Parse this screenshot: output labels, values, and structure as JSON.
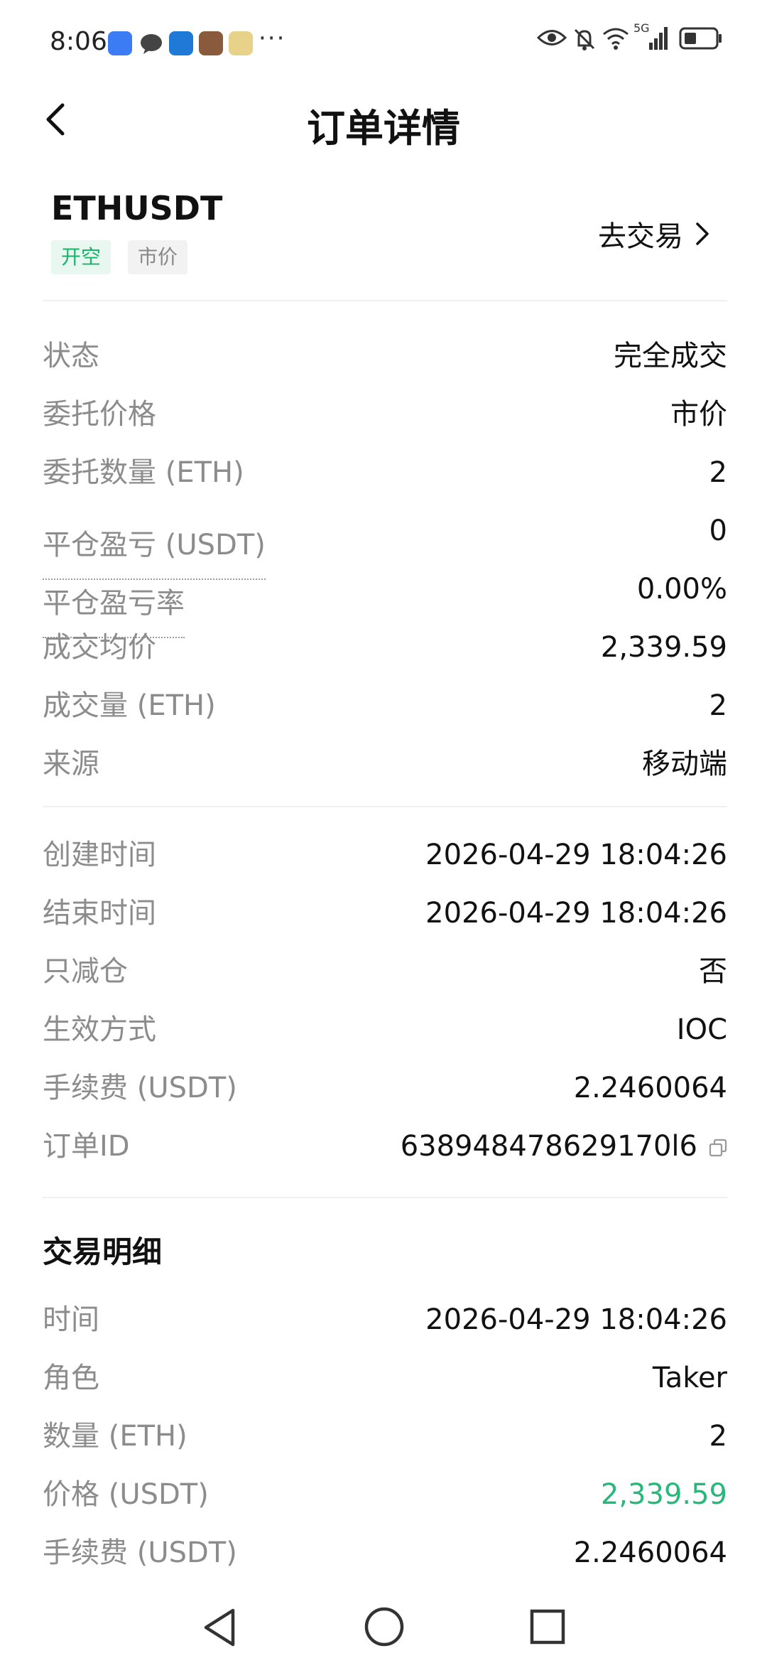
{
  "status_bar": {
    "time": "8:06",
    "dots": "···",
    "network": "5G"
  },
  "header": {
    "title": "订单详情"
  },
  "symbol": {
    "name": "ETHUSDT",
    "tags": [
      "开空",
      "市价"
    ],
    "trade_link": "去交易"
  },
  "order_details": [
    {
      "label": "状态",
      "value": "完全成交"
    },
    {
      "label": "委托价格",
      "value": "市价"
    },
    {
      "label": "委托数量 (ETH)",
      "value": "2"
    },
    {
      "label": "平仓盈亏 (USDT)",
      "value": "0"
    },
    {
      "label": "平仓盈亏率",
      "value": "0.00%"
    },
    {
      "label": "成交均价",
      "value": "2,339.59"
    },
    {
      "label": "成交量 (ETH)",
      "value": "2"
    },
    {
      "label": "来源",
      "value": "移动端"
    }
  ],
  "order_meta": [
    {
      "label": "创建时间",
      "value": "2026-04-29 18:04:26"
    },
    {
      "label": "结束时间",
      "value": "2026-04-29 18:04:26"
    },
    {
      "label": "只减仓",
      "value": "否"
    },
    {
      "label": "生效方式",
      "value": "IOC"
    },
    {
      "label": "手续费 (USDT)",
      "value": "2.2460064"
    },
    {
      "label": "订单ID",
      "value": "638948478629170l6"
    }
  ],
  "trade_details": {
    "title": "交易明细",
    "rows": [
      {
        "label": "时间",
        "value": "2026-04-29 18:04:26"
      },
      {
        "label": "角色",
        "value": "Taker"
      },
      {
        "label": "数量 (ETH)",
        "value": "2"
      },
      {
        "label": "价格 (USDT)",
        "value": "2,339.59"
      },
      {
        "label": "手续费 (USDT)",
        "value": "2.2460064"
      }
    ]
  },
  "colors": {
    "accent_green": "#26b97a",
    "tag_green": "#19b36b",
    "label_gray": "#8c8c8c"
  }
}
